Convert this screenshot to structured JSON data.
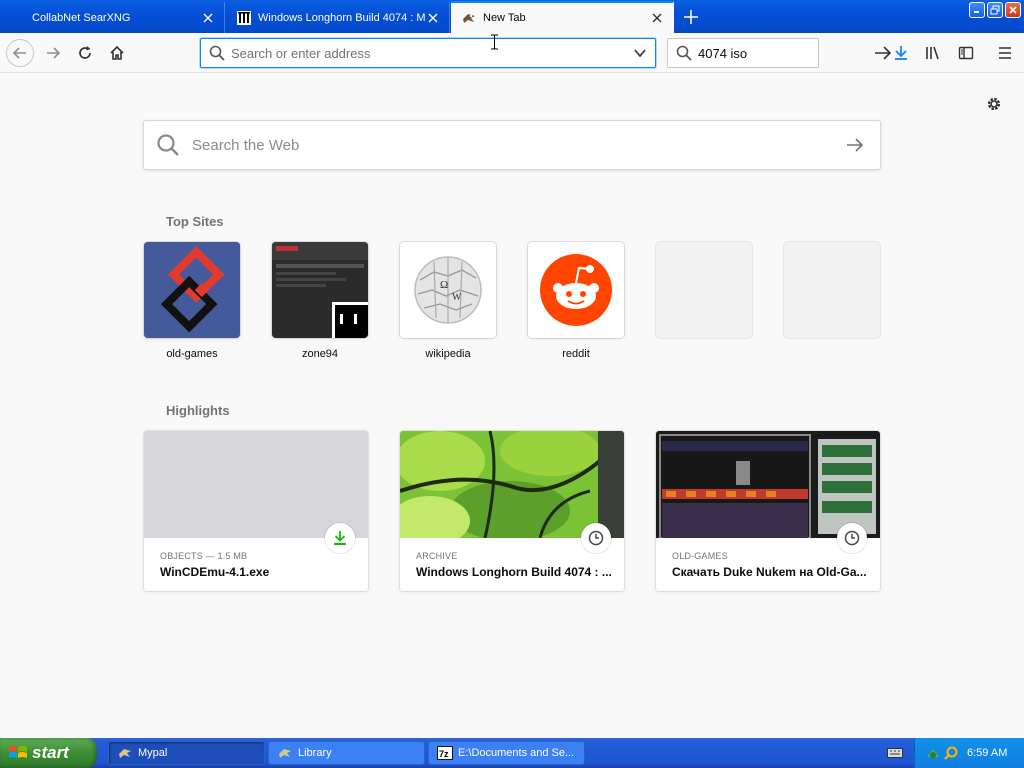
{
  "browser": {
    "tabs": [
      {
        "title": "CollabNet SearXNG",
        "active": false
      },
      {
        "title": "Windows Longhorn Build 4074 : M",
        "active": false
      },
      {
        "title": "New Tab",
        "active": true
      }
    ],
    "urlbar": {
      "placeholder": "Search or enter address",
      "value": ""
    },
    "searchbar": {
      "value": "4074 iso"
    }
  },
  "newtab": {
    "web_search_placeholder": "Search the Web",
    "top_sites_heading": "Top Sites",
    "top_sites": [
      {
        "label": "old-games"
      },
      {
        "label": "zone94"
      },
      {
        "label": "wikipedia"
      },
      {
        "label": "reddit"
      },
      {
        "label": ""
      },
      {
        "label": ""
      }
    ],
    "highlights_heading": "Highlights",
    "highlights": [
      {
        "context": "OBJECTS — 1.5 MB",
        "title": "WinCDEmu-4.1.exe",
        "badge": "download-icon"
      },
      {
        "context": "ARCHIVE",
        "title": "Windows Longhorn Build 4074 : ...",
        "badge": "clock-icon"
      },
      {
        "context": "OLD-GAMES",
        "title": "Скачать Duke Nukem на Old-Ga...",
        "badge": "clock-icon"
      }
    ]
  },
  "taskbar": {
    "start_label": "start",
    "tasks": [
      {
        "label": "Mypal",
        "current": true
      },
      {
        "label": "Library",
        "current": false
      },
      {
        "label": "E:\\Documents and Se...",
        "current": false
      }
    ],
    "clock": "6:59 AM"
  },
  "colors": {
    "accent": "#0a84ff",
    "xp_blue": "#0550d8",
    "start_green": "#3c8f36",
    "reddit_orange": "#ff4500"
  }
}
